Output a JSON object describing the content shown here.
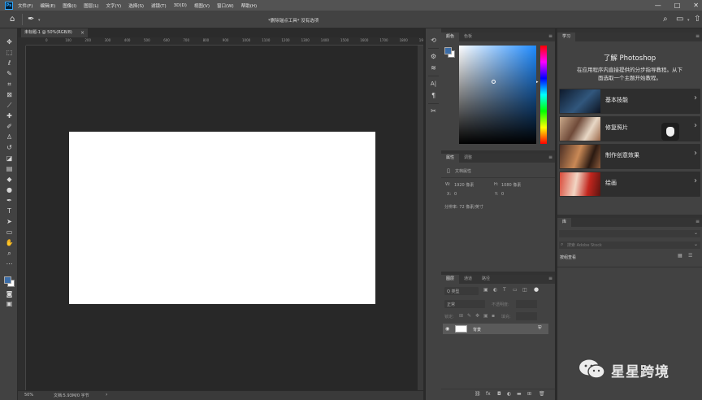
{
  "app": {
    "logo": "Ps"
  },
  "menu": [
    "文件(F)",
    "编辑(E)",
    "图像(I)",
    "图层(L)",
    "文字(Y)",
    "选择(S)",
    "滤镜(T)",
    "3D(D)",
    "视图(V)",
    "窗口(W)",
    "帮助(H)"
  ],
  "window_controls": {
    "minimize": "—",
    "maximize": "□",
    "close": "✕"
  },
  "options_bar": {
    "hint": "*删除锚点工具* 没有选项",
    "home_icon": "⌂",
    "tool_icon": "✒"
  },
  "document": {
    "tab_label": "未标题-1 @ 50%(RGB/8)",
    "tab_close": "×",
    "zoom": "50%",
    "doc_info": "文档:5.93M/0 字节"
  },
  "ruler_marks": [
    "0",
    "100",
    "200",
    "300",
    "400",
    "500",
    "600",
    "700",
    "800",
    "900",
    "1000",
    "1100",
    "1200",
    "1300",
    "1400",
    "1500",
    "1600",
    "1700",
    "1800",
    "1900"
  ],
  "color_panel": {
    "tabs": [
      "颜色",
      "色板"
    ],
    "active": 0
  },
  "properties_panel": {
    "tabs": [
      "属性",
      "调整"
    ],
    "active": 0,
    "section": "文档属性",
    "w_label": "W:",
    "w_value": "1920 像素",
    "h_label": "H:",
    "h_value": "1080 像素",
    "x_label": "X:",
    "x_value": "0",
    "y_label": "Y:",
    "y_value": "0",
    "resolution": "分辨率: 72 像素/英寸"
  },
  "layers_panel": {
    "tabs": [
      "图层",
      "通道",
      "路径"
    ],
    "active": 0,
    "filter_placeholder": "Q 类型",
    "blend_mode": "正常",
    "opacity_label": "不透明度:",
    "lock_label": "锁定:",
    "fill_label": "填充:",
    "layer_name": "背景",
    "lock_icon": "🔒"
  },
  "learn_panel": {
    "tab": "学习",
    "title": "了解 Photoshop",
    "desc_line1": "在应用程序内直接提供的分步指导教程。从下",
    "desc_line2": "面选取一个主题开始教程。",
    "items": [
      {
        "label": "基本技能"
      },
      {
        "label": "修复照片"
      },
      {
        "label": "制作创意效果"
      },
      {
        "label": "绘画"
      }
    ]
  },
  "library_panel": {
    "tab": "库",
    "search_placeholder": "搜索 Adobe Stock",
    "filter_label": "按组查看"
  },
  "watermark": {
    "text": "星星跨境"
  },
  "colors": {
    "accent": "#31a8ff",
    "foreground": "#3b6da8",
    "background": "#ffffff"
  }
}
